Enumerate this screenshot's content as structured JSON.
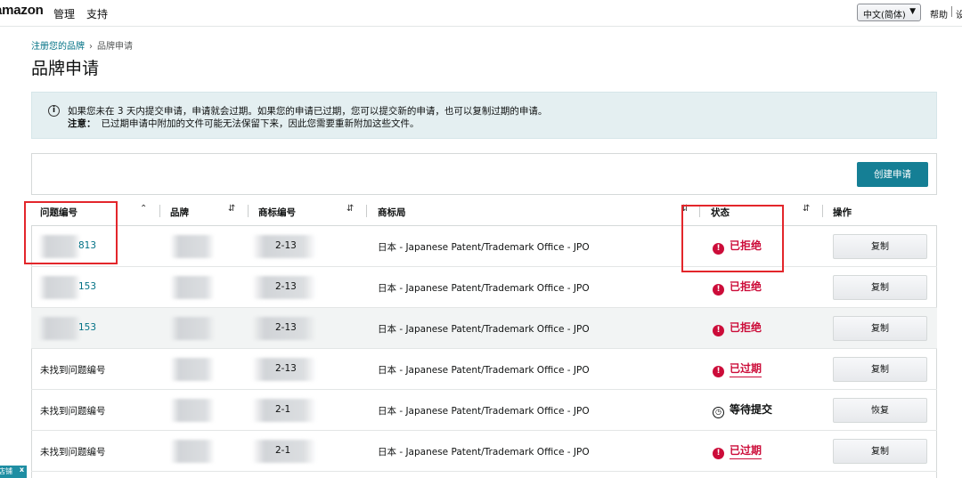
{
  "nav": {
    "logo": "amazon",
    "links": [
      "管理",
      "支持"
    ],
    "language": "中文(简体)",
    "help": "帮助",
    "settings": "设"
  },
  "breadcrumb": {
    "parent": "注册您的品牌",
    "current": "品牌申请"
  },
  "page_title": "品牌申请",
  "info": {
    "line1": "如果您未在 3 天内提交申请，申请就会过期。如果您的申请已过期，您可以提交新的申请，也可以复制过期的申请。",
    "note_label": "注意：",
    "note_text": "已过期申请中附加的文件可能无法保留下来，因此您需要重新附加这些文件。"
  },
  "create_button": "创建申请",
  "table": {
    "headers": [
      "问题编号",
      "品牌",
      "商标编号",
      "商标局",
      "状态",
      "操作"
    ],
    "rows": [
      {
        "case": "813",
        "case_link": true,
        "tm": "2-13",
        "office": "日本 - Japanese Patent/Trademark Office - JPO",
        "status": "已拒绝",
        "status_kind": "rejected",
        "action": "复制"
      },
      {
        "case": "153",
        "case_link": true,
        "tm": "2-13",
        "office": "日本 - Japanese Patent/Trademark Office - JPO",
        "status": "已拒绝",
        "status_kind": "rejected",
        "action": "复制"
      },
      {
        "case": "153",
        "case_link": true,
        "tm": "2-13",
        "office": "日本 - Japanese Patent/Trademark Office - JPO",
        "status": "已拒绝",
        "status_kind": "rejected",
        "action": "复制"
      },
      {
        "case": "未找到问题编号",
        "case_link": false,
        "tm": "2-13",
        "office": "日本 - Japanese Patent/Trademark Office - JPO",
        "status": "已过期",
        "status_kind": "expired",
        "action": "复制"
      },
      {
        "case": "未找到问题编号",
        "case_link": false,
        "tm": "2-1",
        "office": "日本 - Japanese Patent/Trademark Office - JPO",
        "status": "等待提交",
        "status_kind": "pending",
        "action": "恢复"
      },
      {
        "case": "未找到问题编号",
        "case_link": false,
        "tm": "2-1",
        "office": "日本 - Japanese Patent/Trademark Office - JPO",
        "status": "已过期",
        "status_kind": "expired",
        "action": "复制"
      }
    ]
  },
  "badge": {
    "label": "店铺",
    "close": "x"
  },
  "colors": {
    "accent": "#157f95",
    "link": "#007185",
    "error": "#cc0c39",
    "info_bg": "#e4eff1"
  }
}
